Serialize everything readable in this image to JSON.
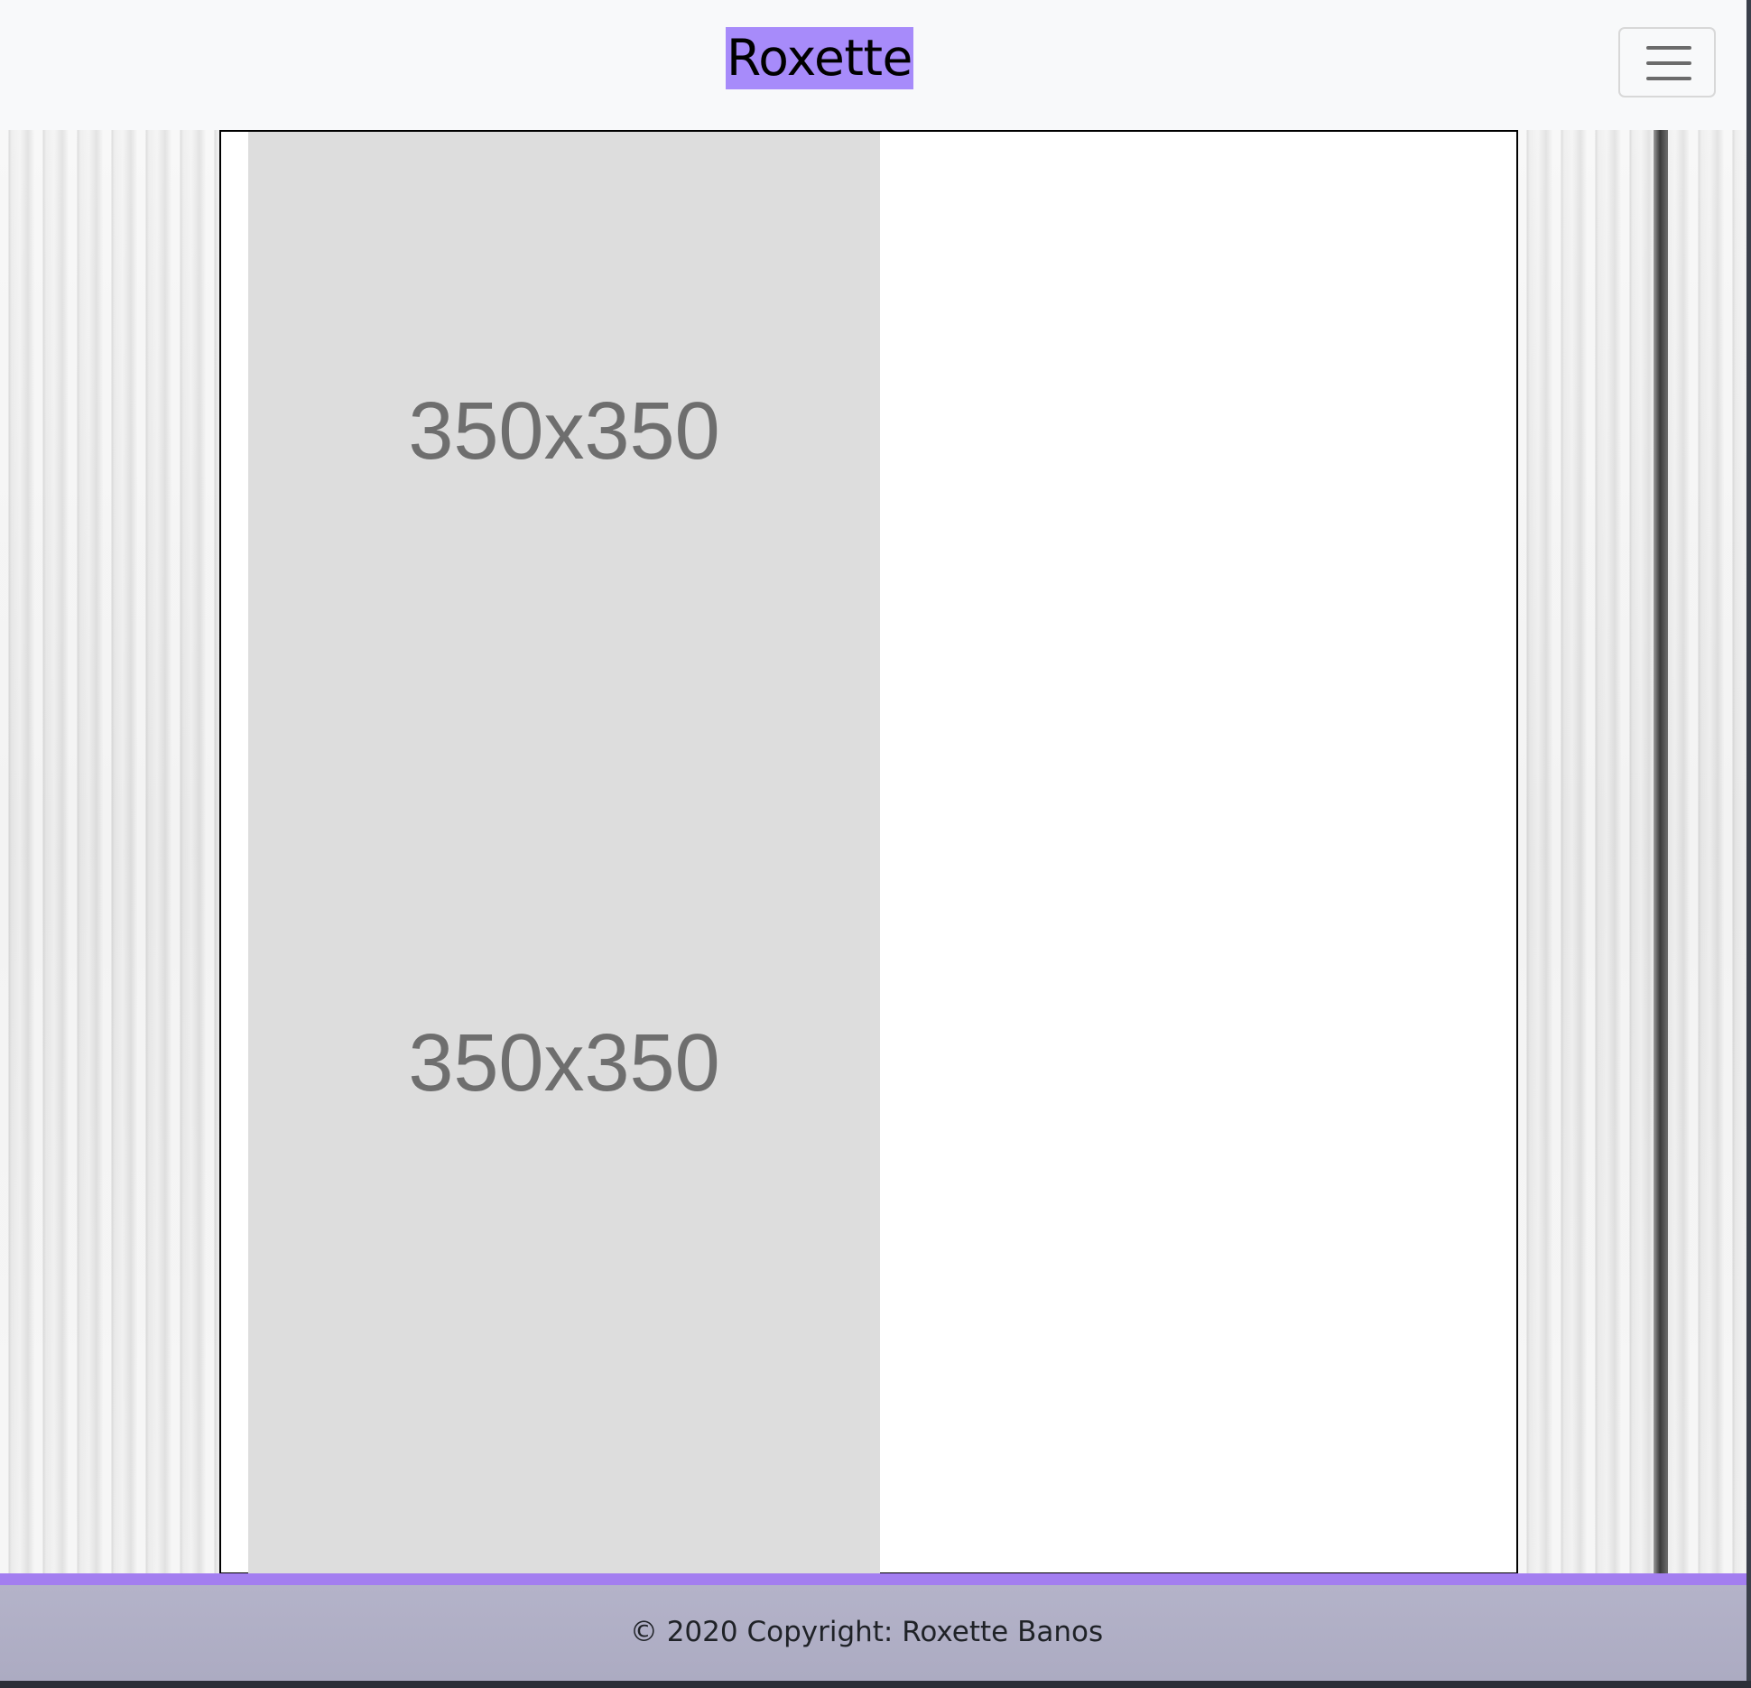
{
  "header": {
    "brand": "Roxette",
    "menu_toggle": {
      "icon": "hamburger-menu-icon"
    }
  },
  "main": {
    "placeholders": [
      {
        "label": "350x350"
      },
      {
        "label": "350x350"
      }
    ]
  },
  "footer": {
    "copyright": "© 2020 Copyright: Roxette Banos"
  },
  "colors": {
    "brand_highlight": "#a78bfa",
    "footer_accent": "#a37ef0",
    "footer_background": "#b4b3c9",
    "navbar_background": "#f8f9fa",
    "placeholder_background": "#dddddd"
  }
}
